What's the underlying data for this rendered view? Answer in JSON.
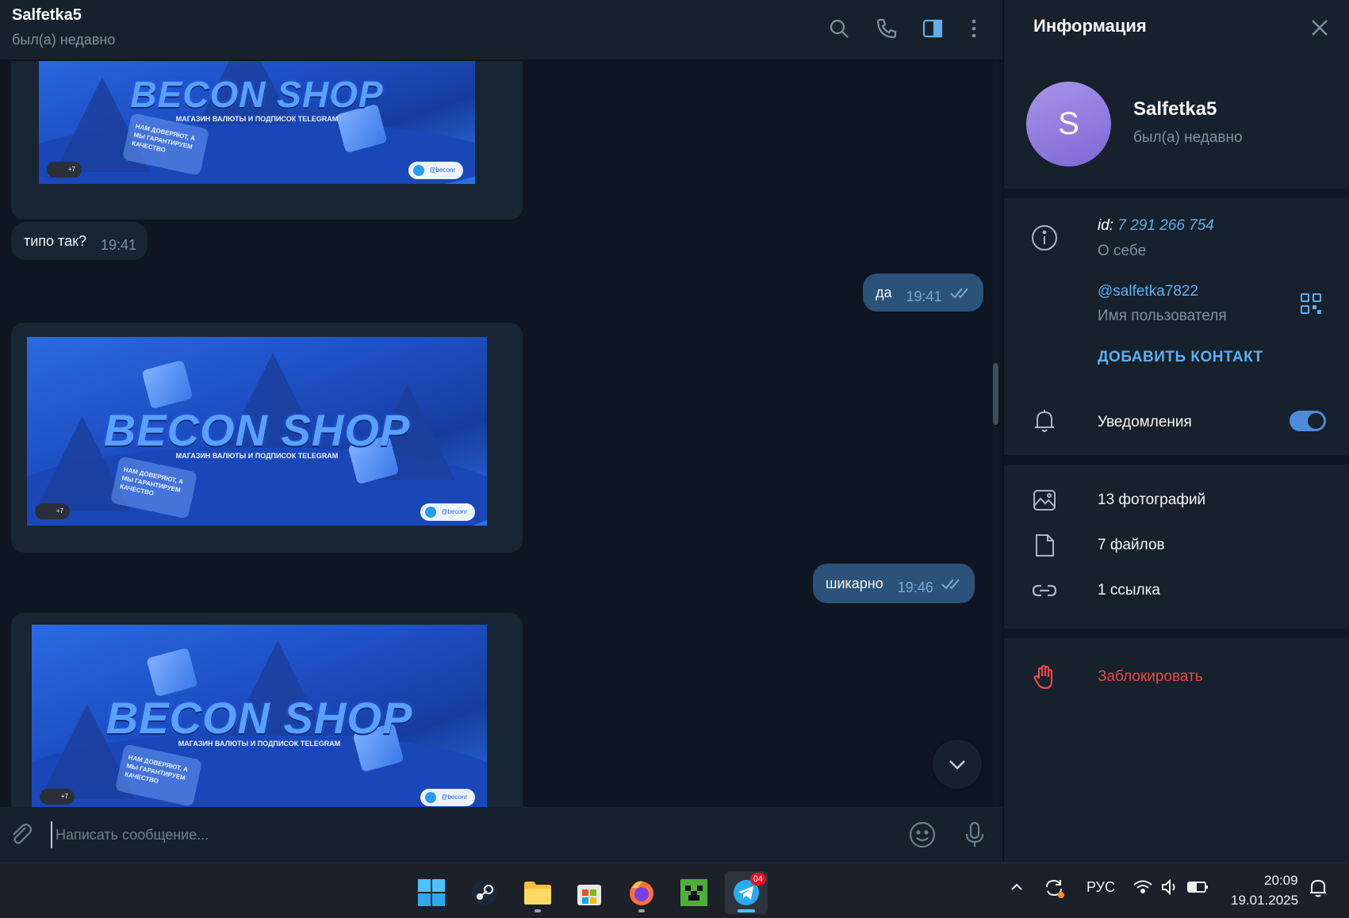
{
  "header": {
    "chat_title": "Salfetka5",
    "chat_status": "был(а) недавно"
  },
  "messages": {
    "banner": {
      "brand": "BECON SHOP",
      "tagline": "МАГАЗИН ВАЛЮТЫ И ПОДПИСОК TELEGRAM",
      "card_text": "НАМ ДОВЕРЯЮТ, А МЫ ГАРАНТИРУЕМ КАЧЕСТВО",
      "handle": "@beconr",
      "avatars_count": "+7"
    },
    "items": [
      {
        "type": "text",
        "direction": "in",
        "text": "типо так?",
        "time": "19:41"
      },
      {
        "type": "text",
        "direction": "out",
        "text": "да",
        "time": "19:41"
      },
      {
        "type": "text",
        "direction": "out",
        "text": "шикарно",
        "time": "19:46"
      }
    ]
  },
  "composer": {
    "placeholder": "Написать сообщение..."
  },
  "info": {
    "title": "Информация",
    "avatar_letter": "S",
    "name": "Salfetka5",
    "status": "был(а) недавно",
    "id_label": "id:",
    "id_value": "7 291 266 754",
    "about_label": "О себе",
    "username": "@salfetka7822",
    "username_label": "Имя пользователя",
    "add_contact": "ДОБАВИТЬ КОНТАКТ",
    "notifications_label": "Уведомления",
    "notifications_on": true,
    "photos": "13 фотографий",
    "files": "7 файлов",
    "links": "1 ссылка",
    "block": "Заблокировать"
  },
  "taskbar": {
    "apps": [
      "windows-start",
      "steam",
      "file-explorer",
      "microsoft-store",
      "firefox",
      "minecraft",
      "telegram"
    ],
    "telegram_badge": "04",
    "language": "РУС",
    "time": "20:09",
    "date": "19.01.2025"
  },
  "colors": {
    "background": "#0e1621",
    "panel": "#17212b",
    "outgoing_bubble": "#2b5278",
    "incoming_bubble": "#182533",
    "accent": "#5eaef0",
    "danger": "#e74a4a",
    "avatar": "#8f7ee0"
  }
}
